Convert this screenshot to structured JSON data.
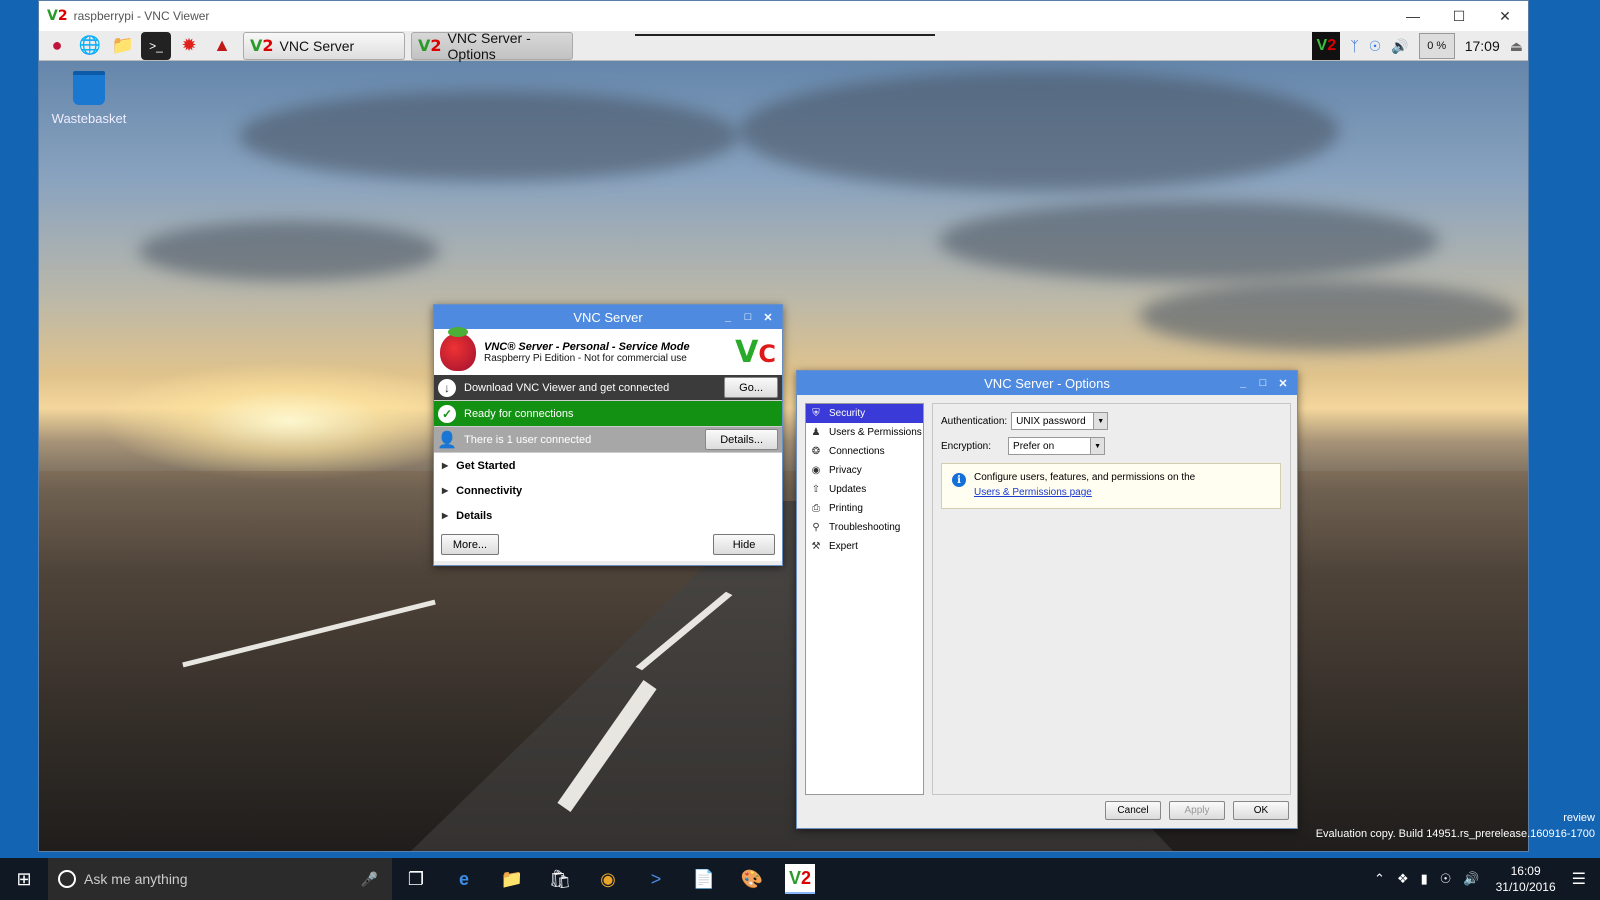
{
  "viewer": {
    "title": "raspberrypi - VNC Viewer",
    "logo": "V2"
  },
  "pi_taskbar": {
    "launchers": [
      "raspberry-menu-icon",
      "globe-icon",
      "folder-icon",
      "terminal-icon",
      "wolfram-icon",
      "mathematica-icon"
    ],
    "task_buttons": [
      {
        "label": "VNC Server",
        "active": false
      },
      {
        "label": "VNC Server - Options",
        "active": true
      }
    ],
    "tray": {
      "cpu": "0 %",
      "time": "17:09"
    }
  },
  "desktop": {
    "icons": [
      {
        "label": "Wastebasket"
      }
    ]
  },
  "vnc_server": {
    "title": "VNC Server",
    "product": "VNC® Server - Personal - Service Mode",
    "edition": "Raspberry Pi Edition - Not for commercial use",
    "rows": [
      {
        "text": "Download VNC Viewer and get connected",
        "button": "Go..."
      },
      {
        "text": "Ready for connections",
        "button": ""
      },
      {
        "text": "There is 1 user connected",
        "button": "Details..."
      }
    ],
    "sections": [
      "Get Started",
      "Connectivity",
      "Details"
    ],
    "more_button": "More...",
    "hide_button": "Hide"
  },
  "vnc_options": {
    "title": "VNC Server - Options",
    "sidebar": [
      {
        "label": "Security",
        "icon": "shield-icon",
        "selected": true
      },
      {
        "label": "Users & Permissions",
        "icon": "user-icon",
        "selected": false
      },
      {
        "label": "Connections",
        "icon": "connections-icon",
        "selected": false
      },
      {
        "label": "Privacy",
        "icon": "eye-icon",
        "selected": false
      },
      {
        "label": "Updates",
        "icon": "updates-icon",
        "selected": false
      },
      {
        "label": "Printing",
        "icon": "printer-icon",
        "selected": false
      },
      {
        "label": "Troubleshooting",
        "icon": "magnifier-icon",
        "selected": false
      },
      {
        "label": "Expert",
        "icon": "wrench-icon",
        "selected": false
      }
    ],
    "authentication_label": "Authentication:",
    "authentication_value": "UNIX password",
    "encryption_label": "Encryption:",
    "encryption_value": "Prefer on",
    "info_text": "Configure users, features, and permissions on the",
    "info_link": "Users & Permissions page",
    "buttons": {
      "cancel": "Cancel",
      "apply": "Apply",
      "ok": "OK"
    }
  },
  "windows_taskbar": {
    "search_placeholder": "Ask me anything",
    "clock_time": "16:09",
    "clock_date": "31/10/2016",
    "watermark_1": "review",
    "watermark_2": "Evaluation copy. Build 14951.rs_prerelease.160916-1700"
  }
}
